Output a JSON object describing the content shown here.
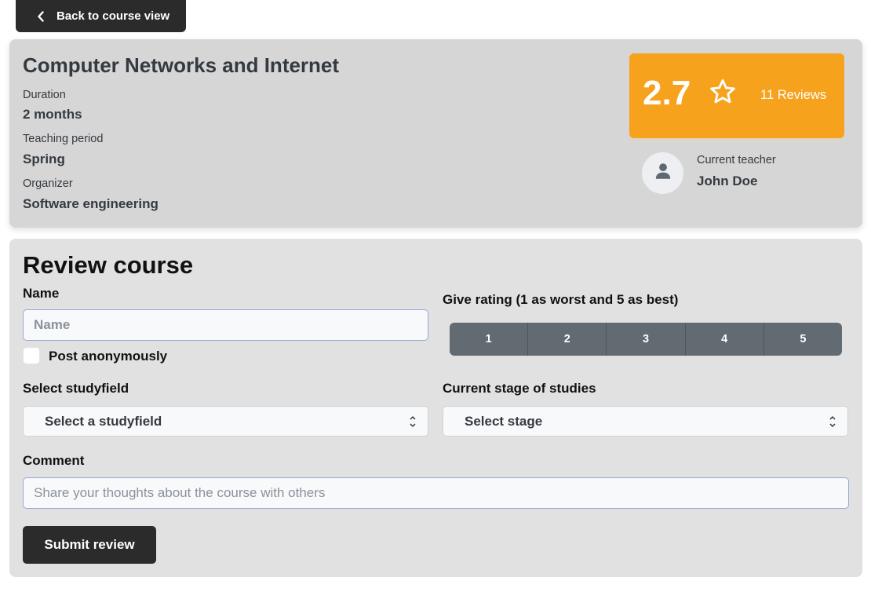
{
  "back_button": {
    "label": "Back to course view"
  },
  "course": {
    "title": "Computer Networks and Internet",
    "info": [
      {
        "label": "Duration",
        "value": "2 months"
      },
      {
        "label": "Teaching period",
        "value": "Spring"
      },
      {
        "label": "Organizer",
        "value": "Software engineering"
      }
    ],
    "rating": "2.7",
    "reviews": "11 Reviews",
    "teacher_label": "Current teacher",
    "teacher_name": "John Doe"
  },
  "review_form": {
    "title": "Review course",
    "name_label": "Name",
    "name_placeholder": "Name",
    "anonymous_label": "Post anonymously",
    "rating_label": "Give rating (1 as worst and 5 as best)",
    "rating_options": [
      "1",
      "2",
      "3",
      "4",
      "5"
    ],
    "studyfield_label": "Select studyfield",
    "studyfield_value": "Select a studyfield",
    "stage_label": "Current stage of studies",
    "stage_value": "Select stage",
    "comment_label": "Comment",
    "comment_placeholder": "Share your thoughts about the course with others",
    "submit_label": "Submit review"
  },
  "colors": {
    "dark_button": "#2b2b2b",
    "rating_accent": "#f7a21c",
    "rating_buttons": "#626a72",
    "course_card_bg": "#d6d6d6",
    "review_card_bg": "#e1e1e1"
  },
  "icons": {
    "back": "chevron-left-icon",
    "star": "star-outline-icon",
    "avatar": "user-icon",
    "select_arrows": "chevron-up-down-icon"
  }
}
